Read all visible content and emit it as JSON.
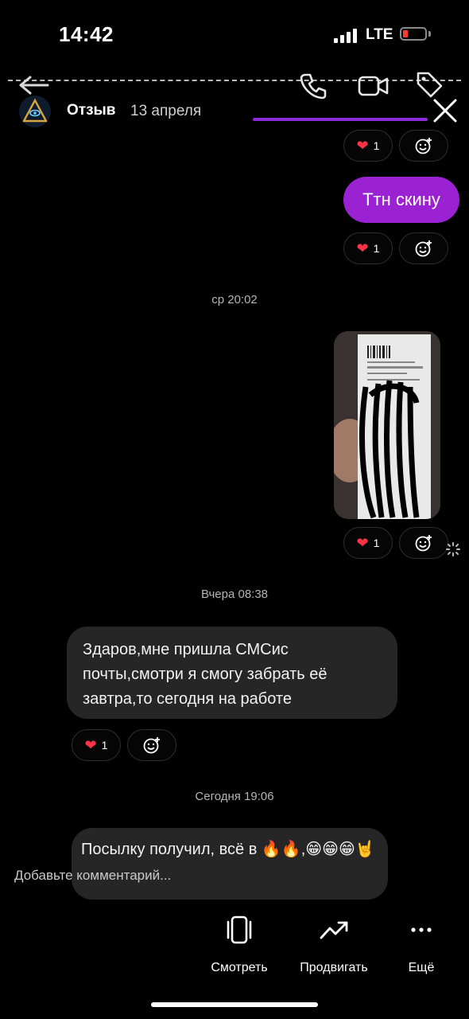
{
  "status_bar": {
    "time": "14:42",
    "network": "LTE",
    "battery_color": "#ff3b30"
  },
  "story": {
    "title": "Отзыв",
    "date": "13 апреля",
    "accent": "#9b22d3"
  },
  "messages": {
    "reaction_count": "1",
    "outgoing_text": "Ттн скину",
    "ts1": "ср 20:02",
    "ts2": "Вчера 08:38",
    "incoming1": "Здаров,мне пришла СМСис почты,смотри я смогу забрать её завтра,то сегодня на работе",
    "ts3": "Сегодня 19:06",
    "incoming2": "Посылку получил, всё в 🔥🔥,😁😁😁🤘"
  },
  "comment_placeholder": "Добавьте комментарий...",
  "actions": [
    {
      "label": "Смотреть",
      "icon": "phone-view-icon"
    },
    {
      "label": "Продвигать",
      "icon": "trending-up-icon"
    },
    {
      "label": "Ещё",
      "icon": "more-dots-icon"
    }
  ]
}
